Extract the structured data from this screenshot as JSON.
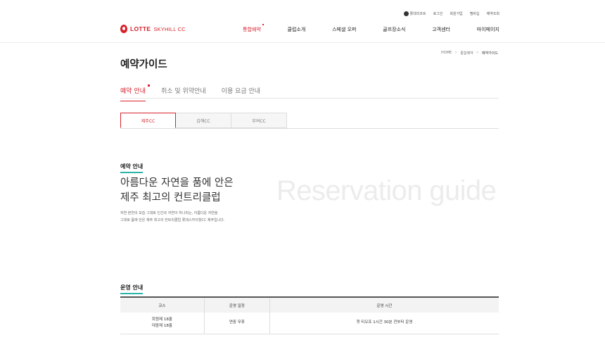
{
  "utility": {
    "lang": "롯데리조트",
    "links": [
      "로그인",
      "회원가입",
      "멤버십",
      "예약조회"
    ]
  },
  "logo": {
    "brand": "LOTTE",
    "sub": "SKYHILL CC"
  },
  "gnb": {
    "items": [
      {
        "label": "통합예약",
        "active": true
      },
      {
        "label": "클럽소개"
      },
      {
        "label": "스페셜 오퍼"
      },
      {
        "label": "골프장소식"
      },
      {
        "label": "고객센터"
      },
      {
        "label": "마이페이지"
      }
    ]
  },
  "breadcrumb": {
    "home": "HOME",
    "mid": "통합예약",
    "current": "예약가이드",
    "sep": ">"
  },
  "page_title": "예약가이드",
  "subtabs": [
    {
      "label": "예약 안내",
      "active": true
    },
    {
      "label": "취소 및 위약안내"
    },
    {
      "label": "이용 요금 안내"
    }
  ],
  "cc_tabs": [
    {
      "label": "제주CC",
      "active": true
    },
    {
      "label": "김해CC"
    },
    {
      "label": "부여CC"
    }
  ],
  "reservation": {
    "section_title": "예약 안내",
    "headline_1": "아름다운 자연을 품에 안은",
    "headline_2": "제주 최고의 컨트리클럽",
    "body_1": "자연 본연의 모습 그대로 인간과 자연이 하나되는, 아름다운 자연을",
    "body_2": "그대로 품에 안은 제주 최고의 컨트리클럽 롯데스카이힐CC 제주입니다.",
    "watermark": "Reservation guide"
  },
  "operation": {
    "section_title": "운영 안내",
    "columns": [
      "코스",
      "운영 일정",
      "운영 시간"
    ],
    "row": {
      "course_1": "회원제 18홀",
      "course_2": "대중제 18홀",
      "schedule": "연중 무휴",
      "hours": "첫 티오프 1시간 30분 전부터 운영"
    }
  }
}
